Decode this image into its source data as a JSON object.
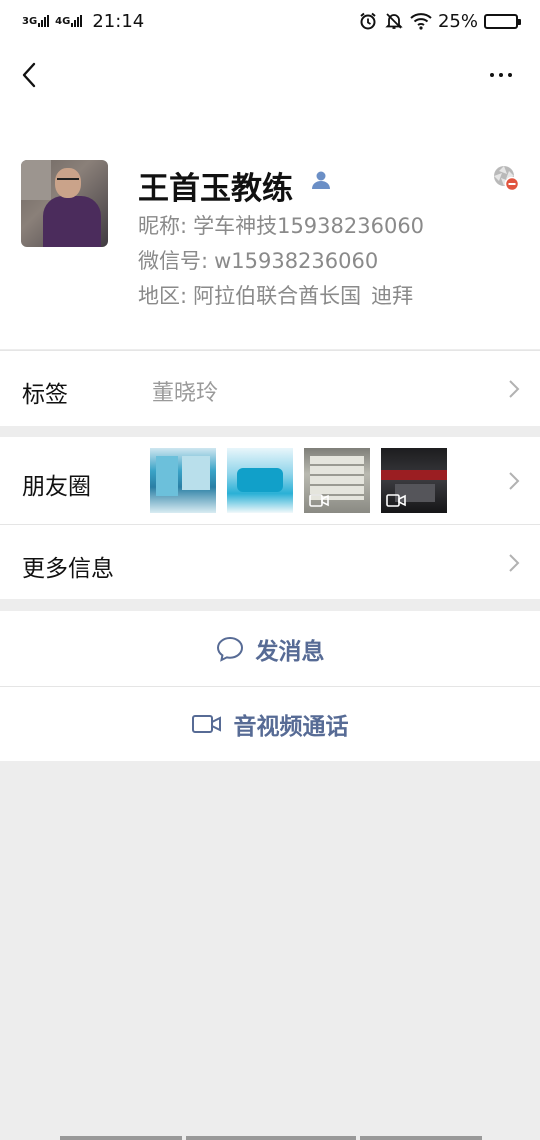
{
  "status_bar": {
    "network1": "3G",
    "network2": "4G",
    "time": "21:14",
    "battery_percent": "25%",
    "battery_level": 0.25
  },
  "nav": {
    "back_icon": "chevron-left-icon",
    "more_icon": "more-dots-icon"
  },
  "profile": {
    "name": "王首玉教练",
    "nickname_label": "昵称:",
    "nickname": "学车神技15938236060",
    "wechat_label": "微信号:",
    "wechat_id": "w15938236060",
    "region_label": "地区:",
    "region_country": "阿拉伯联合酋长国",
    "region_city": "迪拜"
  },
  "rows": {
    "tags_label": "标签",
    "tags_value": "董晓玲",
    "moments_label": "朋友圈",
    "more_info_label": "更多信息"
  },
  "actions": {
    "send_message": "发消息",
    "video_call": "音视频通话"
  },
  "colors": {
    "accent": "#576b95",
    "background": "#ededed"
  }
}
